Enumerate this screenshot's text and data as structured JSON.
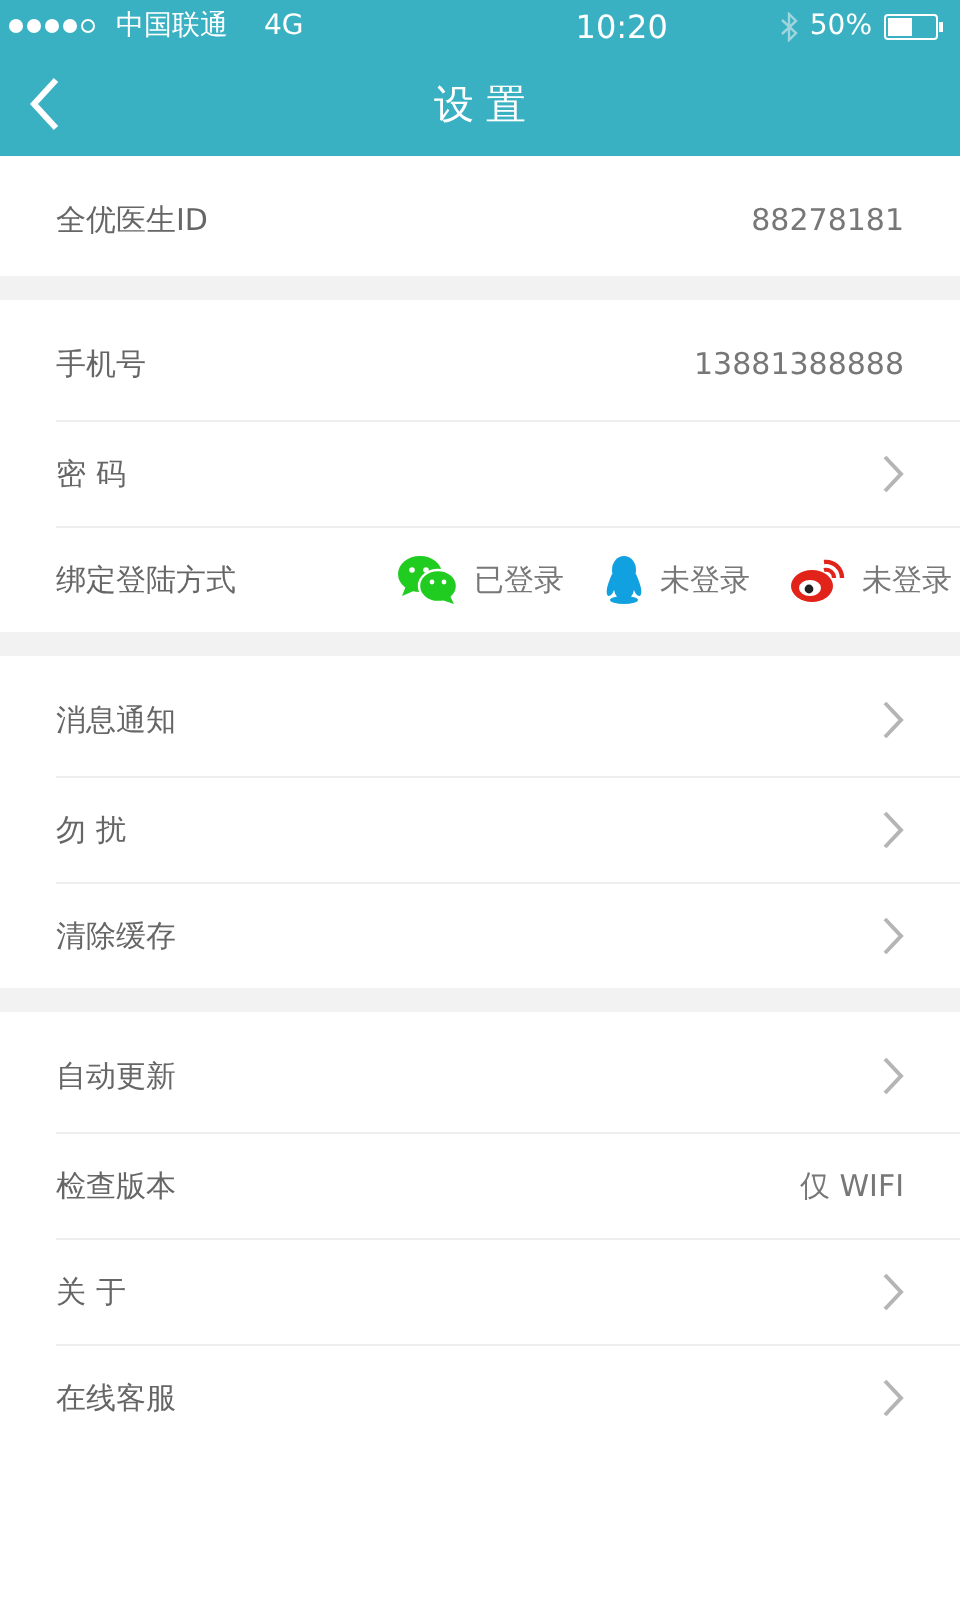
{
  "status_bar": {
    "carrier": "中国联通",
    "network": "4G",
    "time": "10:20",
    "battery": "50%"
  },
  "nav": {
    "title": "设 置"
  },
  "groups": [
    {
      "rows": [
        {
          "kind": "value",
          "label": "全优医生ID",
          "value": "88278181"
        }
      ]
    },
    {
      "rows": [
        {
          "kind": "value",
          "label": "手机号",
          "value": "13881388888"
        },
        {
          "kind": "link",
          "label": "密 码"
        },
        {
          "kind": "bind",
          "label": "绑定登陆方式",
          "accounts": [
            {
              "kind": "wechat",
              "status": "已登录"
            },
            {
              "kind": "qq",
              "status": "未登录"
            },
            {
              "kind": "weibo",
              "status": "未登录"
            }
          ]
        }
      ]
    },
    {
      "rows": [
        {
          "kind": "link",
          "label": "消息通知"
        },
        {
          "kind": "link",
          "label": "勿 扰"
        },
        {
          "kind": "link",
          "label": "清除缓存"
        }
      ]
    },
    {
      "rows": [
        {
          "kind": "link",
          "label": "自动更新"
        },
        {
          "kind": "value",
          "label": "检查版本",
          "value": "仅 WIFI"
        },
        {
          "kind": "link",
          "label": "关 于"
        },
        {
          "kind": "link",
          "label": "在线客服"
        }
      ]
    }
  ]
}
